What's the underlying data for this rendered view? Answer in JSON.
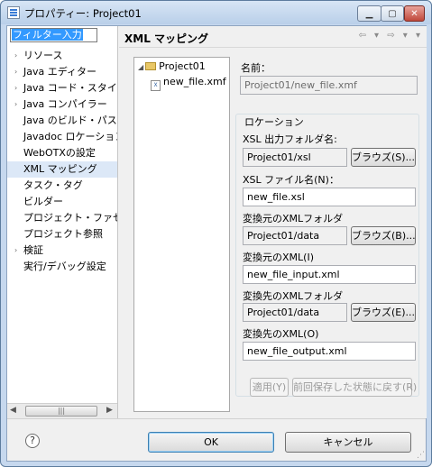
{
  "window": {
    "title": "プロパティー: Project01"
  },
  "nav": {
    "filter_placeholder": "フィルター入力",
    "items": [
      {
        "label": "リソース",
        "expandable": true
      },
      {
        "label": "Java エディター",
        "expandable": true
      },
      {
        "label": "Java コード・スタイル",
        "expandable": true
      },
      {
        "label": "Java コンパイラー",
        "expandable": true
      },
      {
        "label": "Java のビルド・パス",
        "expandable": false
      },
      {
        "label": "Javadoc ロケーション",
        "expandable": false
      },
      {
        "label": "WebOTXの設定",
        "expandable": false
      },
      {
        "label": "XML マッピング",
        "expandable": false,
        "selected": true
      },
      {
        "label": "タスク・タグ",
        "expandable": false
      },
      {
        "label": "ビルダー",
        "expandable": false
      },
      {
        "label": "プロジェクト・ファセット",
        "expandable": false
      },
      {
        "label": "プロジェクト参照",
        "expandable": false
      },
      {
        "label": "検証",
        "expandable": true
      },
      {
        "label": "実行/デバッグ設定",
        "expandable": false
      }
    ]
  },
  "panel": {
    "title": "XML マッピング",
    "tree": {
      "project": "Project01",
      "file": "new_file.xmf"
    },
    "name_label": "名前：",
    "name_value": "Project01/new_file.xmf",
    "location_label": "ロケーション",
    "xsl_folder_label": "XSL 出力フォルダ名:",
    "xsl_folder_value": "Project01/xsl",
    "xsl_file_label": "XSL ファイル名(N)：",
    "xsl_file_value": "new_file.xsl",
    "src_folder_label": "変換元のXMLフォルダ",
    "src_folder_value": "Project01/data",
    "src_xml_label": "変換元のXML(I)",
    "src_xml_value": "new_file_input.xml",
    "dst_folder_label": "変換先のXMLフォルダ",
    "dst_folder_value": "Project01/data",
    "dst_xml_label": "変換先のXML(O)",
    "dst_xml_value": "new_file_output.xml",
    "browse_s": "ブラウズ(S)...",
    "browse_b": "ブラウズ(B)...",
    "browse_e": "ブラウズ(E)...",
    "apply": "適用(Y)",
    "restore": "前回保存した状態に戻す(R)"
  },
  "buttons": {
    "help": "?",
    "ok": "OK",
    "cancel": "キャンセル"
  }
}
